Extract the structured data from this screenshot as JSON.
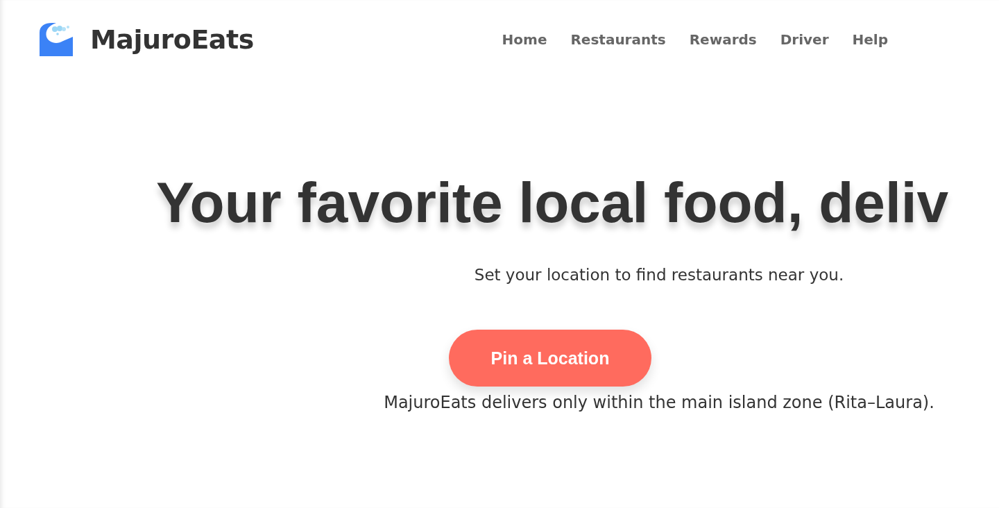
{
  "brand": {
    "name": "MajuroEats"
  },
  "nav": [
    {
      "label": "Home"
    },
    {
      "label": "Restaurants"
    },
    {
      "label": "Rewards"
    },
    {
      "label": "Driver"
    },
    {
      "label": "Help"
    }
  ],
  "hero": {
    "headline": "Your favorite local food, deliv",
    "subtitle": "Set your location to find restaurants near you.",
    "button": "Pin a Location",
    "note": "MajuroEats delivers only within the main island zone (Rita–Laura)."
  }
}
